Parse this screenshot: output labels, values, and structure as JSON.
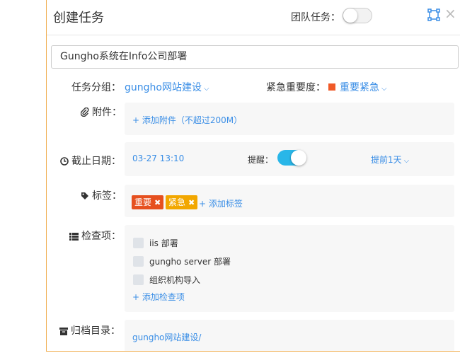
{
  "header": {
    "title": "创建任务",
    "team_task_label": "团队任务：",
    "team_task_enabled": false
  },
  "task_name": {
    "value": "Gungho系统在Info公司部署"
  },
  "group": {
    "label": "任务分组：",
    "value": "gungho网站建设"
  },
  "priority": {
    "label": "紧急重要度：",
    "value": "重要紧急",
    "color": "#f05a28"
  },
  "attachment": {
    "label": "附件：",
    "add_link": "+ 添加附件（不超过200M）"
  },
  "deadline": {
    "label": "截止日期：",
    "value": "03-27 13:10",
    "reminder_label": "提醒：",
    "reminder_enabled": true,
    "advance_value": "提前1天"
  },
  "tags": {
    "label": "标签：",
    "items": [
      {
        "text": "重要",
        "color": "#e6501f"
      },
      {
        "text": "紧急",
        "color": "#f2a700"
      }
    ],
    "add_link": "+ 添加标签"
  },
  "checklist": {
    "label": "检查项：",
    "items": [
      {
        "text": "iis 部署",
        "checked": false
      },
      {
        "text": "gungho server 部署",
        "checked": false
      },
      {
        "text": "组织机构导入",
        "checked": false
      }
    ],
    "add_link": "+ 添加检查项"
  },
  "archive": {
    "label": "归档目录：",
    "value": "gungho网站建设/"
  },
  "colors": {
    "accent": "#3a8ee6",
    "toggle_on": "#29b6e8",
    "dialog_border": "#f0ad4e"
  }
}
